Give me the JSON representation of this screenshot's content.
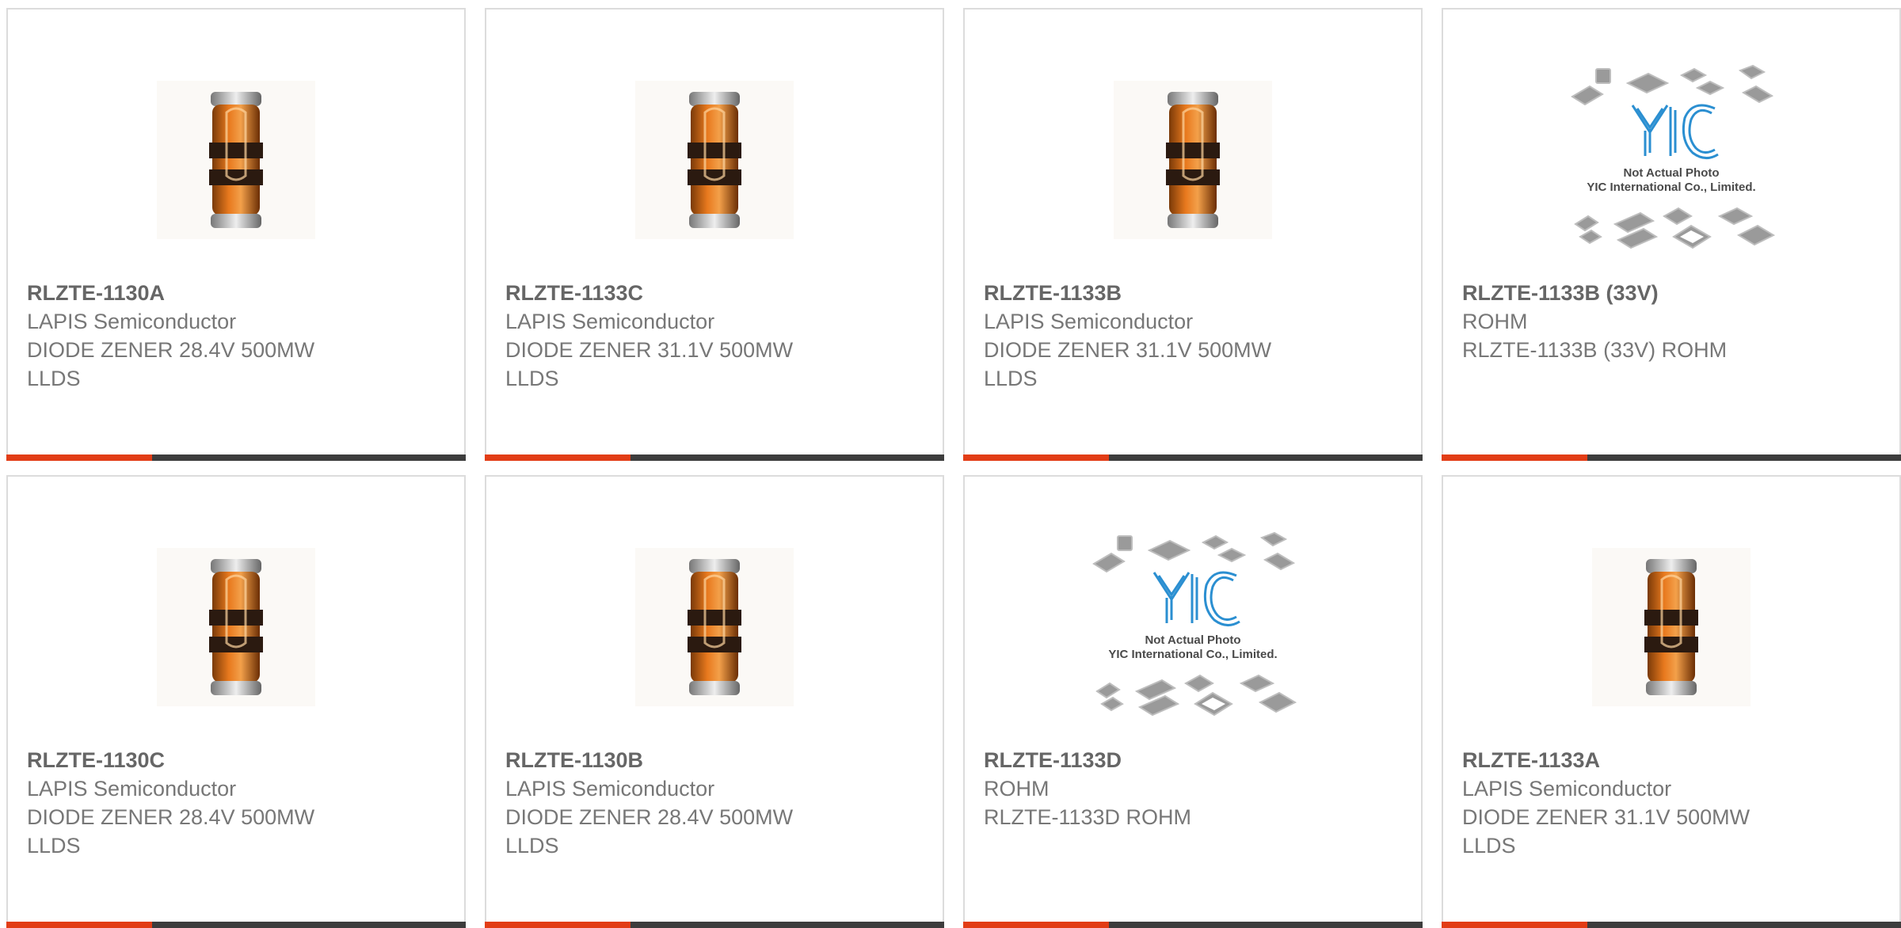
{
  "products": [
    {
      "part_number": "RLZTE-1130A",
      "lines": [
        "LAPIS Semiconductor",
        "DIODE ZENER 28.4V 500MW",
        "LLDS"
      ],
      "image": "zener-diode-photo"
    },
    {
      "part_number": "RLZTE-1133C",
      "lines": [
        "LAPIS Semiconductor",
        "DIODE ZENER 31.1V 500MW",
        "LLDS"
      ],
      "image": "zener-diode-photo"
    },
    {
      "part_number": "RLZTE-1133B",
      "lines": [
        "LAPIS Semiconductor",
        "DIODE ZENER 31.1V 500MW",
        "LLDS"
      ],
      "image": "zener-diode-photo"
    },
    {
      "part_number": "RLZTE-1133B (33V)",
      "lines": [
        "ROHM",
        "RLZTE-1133B (33V) ROHM"
      ],
      "image": "yic-placeholder",
      "placeholder_text": [
        "Not Actual Photo",
        "YIC International Co., Limited."
      ]
    },
    {
      "part_number": "RLZTE-1130C",
      "lines": [
        "LAPIS Semiconductor",
        "DIODE ZENER 28.4V 500MW",
        "LLDS"
      ],
      "image": "zener-diode-photo"
    },
    {
      "part_number": "RLZTE-1130B",
      "lines": [
        "LAPIS Semiconductor",
        "DIODE ZENER 28.4V 500MW",
        "LLDS"
      ],
      "image": "zener-diode-photo"
    },
    {
      "part_number": "RLZTE-1133D",
      "lines": [
        "ROHM",
        "RLZTE-1133D ROHM"
      ],
      "image": "yic-placeholder",
      "placeholder_text": [
        "Not Actual Photo",
        "YIC International Co., Limited."
      ]
    },
    {
      "part_number": "RLZTE-1133A",
      "lines": [
        "LAPIS Semiconductor",
        "DIODE ZENER 31.1V 500MW",
        "LLDS"
      ],
      "image": "zener-diode-photo"
    }
  ],
  "colors": {
    "accent": "#e23d16",
    "bar": "#3d3d3d",
    "title": "#666666",
    "text": "#777777",
    "logo_blue": "#1f7fc4"
  }
}
